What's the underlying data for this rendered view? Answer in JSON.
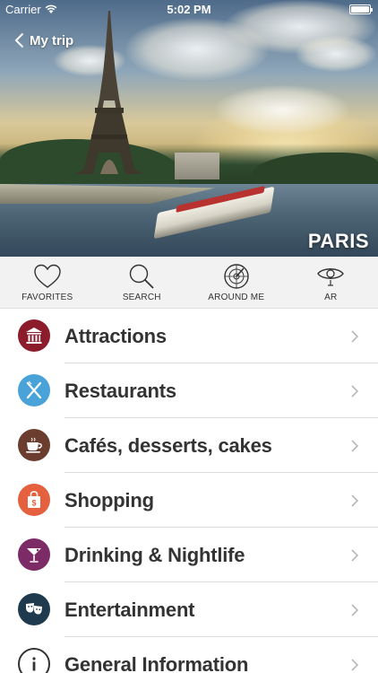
{
  "status_bar": {
    "carrier": "Carrier",
    "time": "5:02 PM"
  },
  "nav": {
    "back_label": "My trip"
  },
  "hero": {
    "city": "PARIS"
  },
  "toolbar": [
    {
      "label": "FAVORITES",
      "icon": "heart-icon"
    },
    {
      "label": "SEARCH",
      "icon": "search-icon"
    },
    {
      "label": "AROUND ME",
      "icon": "radar-icon"
    },
    {
      "label": "AR",
      "icon": "eye-icon"
    }
  ],
  "categories": [
    {
      "label": "Attractions",
      "icon": "museum-icon",
      "color": "#8c1c2b"
    },
    {
      "label": "Restaurants",
      "icon": "fork-knife-icon",
      "color": "#49a3d8"
    },
    {
      "label": "Cafés, desserts, cakes",
      "icon": "coffee-cup-icon",
      "color": "#6b3d2e"
    },
    {
      "label": "Shopping",
      "icon": "shopping-bag-icon",
      "color": "#e4603e"
    },
    {
      "label": "Drinking & Nightlife",
      "icon": "cocktail-icon",
      "color": "#7c2b66"
    },
    {
      "label": "Entertainment",
      "icon": "theater-masks-icon",
      "color": "#1f3a4d"
    },
    {
      "label": "General Information",
      "icon": "info-icon",
      "color": "#333333"
    }
  ]
}
